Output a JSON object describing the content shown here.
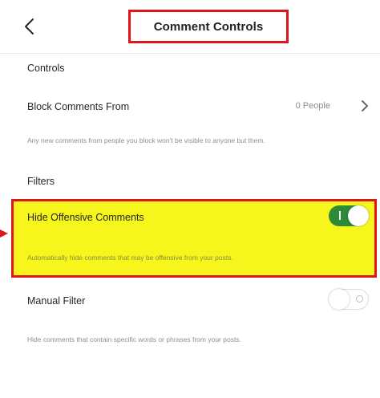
{
  "header": {
    "title": "Comment Controls",
    "back_icon": "chevron-left-icon"
  },
  "controls_section": {
    "label": "Controls",
    "block_comments": {
      "title": "Block Comments From",
      "value": "0 People",
      "description": "Any new comments from people you block won't be visible to anyone but them."
    }
  },
  "filters_section": {
    "label": "Filters",
    "hide_offensive": {
      "title": "Hide Offensive Comments",
      "description": "Automatically hide comments that may be offensive from your posts.",
      "enabled": true
    },
    "manual_filter": {
      "title": "Manual Filter",
      "description": "Hide comments that contain specific words or phrases from your posts.",
      "enabled": false
    }
  },
  "colors": {
    "annotation_red": "#e0151b",
    "highlight_yellow": "#f6f51c",
    "toggle_green": "#2e8a37"
  }
}
